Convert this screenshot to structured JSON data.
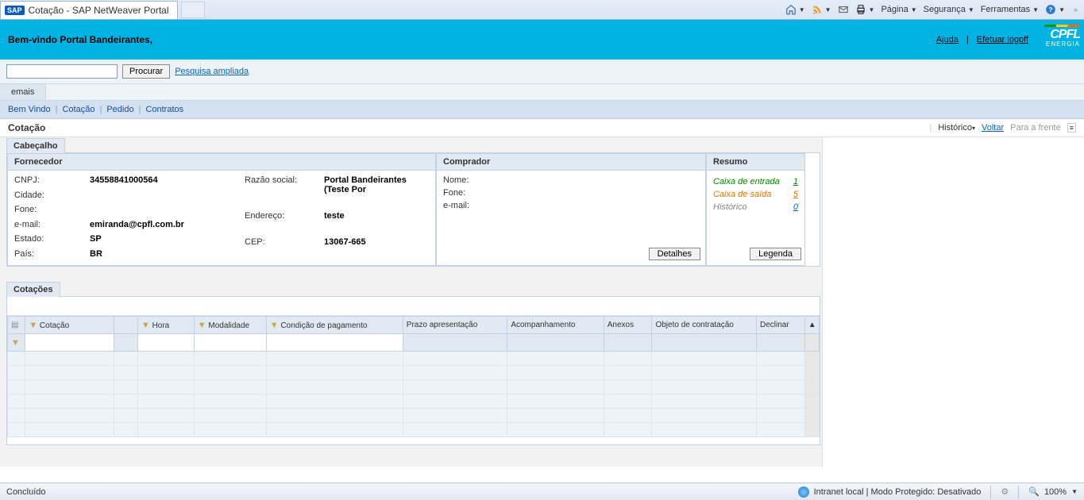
{
  "browser": {
    "tab_title": "Cotação - SAP NetWeaver Portal",
    "sap_badge": "SAP",
    "tools": {
      "pagina": "Página",
      "seguranca": "Segurança",
      "ferramentas": "Ferramentas"
    }
  },
  "portal": {
    "welcome": "Bem-vindo Portal Bandeirantes,",
    "help": "Ajuda",
    "logoff": "Efetuar logoff",
    "brand": "CPFL",
    "brand_sub": "ENERGIA"
  },
  "search": {
    "button": "Procurar",
    "advanced": "Pesquisa ampliada",
    "value": ""
  },
  "tabs": {
    "top1": "emais"
  },
  "nav": {
    "bem_vindo": "Bem Vindo",
    "cotacao": "Cotação",
    "pedido": "Pedido",
    "contratos": "Contratos"
  },
  "page": {
    "title": "Cotação",
    "historico": "Histórico",
    "voltar": "Voltar",
    "frente": "Para a frente"
  },
  "cabecalho": {
    "label": "Cabeçalho",
    "fornecedor": {
      "title": "Fornecedor",
      "cnpj_k": "CNPJ:",
      "cnpj_v": "34558841000564",
      "cidade_k": "Cidade:",
      "cidade_v": "",
      "fone_k": "Fone:",
      "fone_v": "",
      "email_k": "e-mail:",
      "email_v": "emiranda@cpfl.com.br",
      "estado_k": "Estado:",
      "estado_v": "SP",
      "pais_k": "País:",
      "pais_v": "BR",
      "razao_k": "Razão social:",
      "razao_v": "Portal Bandeirantes (Teste Por",
      "end_k": "Endereço:",
      "end_v": "teste",
      "cep_k": "CEP:",
      "cep_v": "13067-665"
    },
    "comprador": {
      "title": "Comprador",
      "nome_k": "Nome:",
      "fone_k": "Fone:",
      "email_k": "e-mail:",
      "detalhes": "Detalhes"
    },
    "resumo": {
      "title": "Resumo",
      "inbox": "Caixa de entrada",
      "inbox_n": "1",
      "outbox": "Caixa de saída",
      "outbox_n": "5",
      "hist": "Histórico",
      "hist_n": "0",
      "legenda": "Legenda"
    }
  },
  "cotacoes": {
    "label": "Cotações",
    "columns": {
      "cotacao": "Cotação",
      "hora": "Hora",
      "modalidade": "Modalidade",
      "cond": "Condição de pagamento",
      "prazo": "Prazo apresentação",
      "acomp": "Acompanhamento",
      "anexos": "Anexos",
      "objeto": "Objeto de contratação",
      "declinar": "Declinar"
    }
  },
  "status": {
    "done": "Concluído",
    "zone": "Intranet local | Modo Protegido: Desativado",
    "zoom": "100%"
  }
}
